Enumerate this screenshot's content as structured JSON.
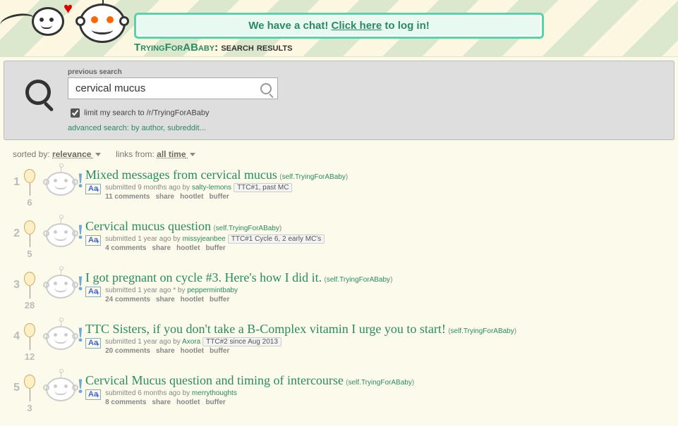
{
  "header": {
    "chat_banner_prefix": "We have a chat! ",
    "chat_banner_link": "Click here",
    "chat_banner_suffix": " to log in!",
    "subreddit_name": "TryingForABaby",
    "page_label": ": search results"
  },
  "search": {
    "previous_label": "previous search",
    "query": "cervical mucus",
    "limit_checked": true,
    "limit_label": "limit my search to /r/TryingForABaby",
    "advanced_label": "advanced search: by author, subreddit..."
  },
  "sorter": {
    "sorted_by_label": "sorted by:",
    "sorted_by_value": "relevance",
    "links_from_label": "links from:",
    "links_from_value": "all time"
  },
  "action_labels": {
    "share": "share",
    "hootlet": "hootlet",
    "buffer": "buffer",
    "aa": "Aa"
  },
  "results": [
    {
      "rank": "1",
      "score": "6",
      "title": "Mixed messages from cervical mucus",
      "domain": "self.TryingForABaby",
      "submitted": "submitted 9 months ago by ",
      "author": "salty-lemons",
      "flair": "TTC#1, past MC",
      "comments": "11 comments"
    },
    {
      "rank": "2",
      "score": "5",
      "title": "Cervical mucus question",
      "domain": "self.TryingForABaby",
      "submitted": "submitted 1 year ago by ",
      "author": "missyjeanbee",
      "flair": "TTC#1 Cycle 6, 2 early MC's",
      "comments": "4 comments"
    },
    {
      "rank": "3",
      "score": "28",
      "title": "I got pregnant on cycle #3. Here's how I did it.",
      "domain": "self.TryingForABaby",
      "submitted": "submitted 1 year ago * by ",
      "author": "peppermintbaby",
      "flair": "",
      "comments": "24 comments"
    },
    {
      "rank": "4",
      "score": "12",
      "title": "TTC Sisters, if you don't take a B-Complex vitamin I urge you to start!",
      "domain": "self.TryingForABaby",
      "submitted": "submitted 1 year ago by ",
      "author": "Axora",
      "flair": "TTC#2 since Aug 2013",
      "comments": "20 comments"
    },
    {
      "rank": "5",
      "score": "3",
      "title": "Cervical Mucus question and timing of intercourse",
      "domain": "self.TryingForABaby",
      "submitted": "submitted 6 months ago by ",
      "author": "merrythoughts",
      "flair": "",
      "comments": "8 comments"
    }
  ]
}
